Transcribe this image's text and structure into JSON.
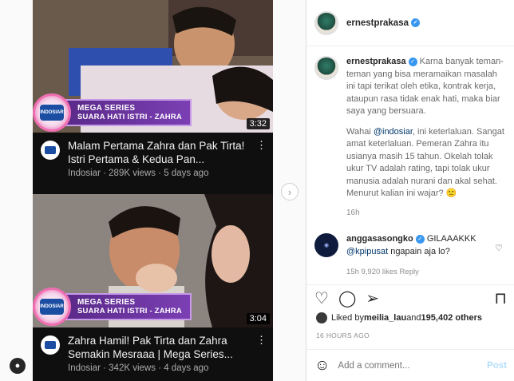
{
  "post": {
    "username": "ernestprakasa",
    "caption_p1": "Karna banyak teman-teman yang bisa meramaikan masalah ini tapi terikat oleh etika, kontrak kerja, ataupun rasa tidak enak hati, maka biar saya yang bersuara.",
    "caption_p2_a": "Wahai ",
    "caption_mention": "@indosiar",
    "caption_p2_b": ", ini keterlaluan. Sangat amat keterlaluan. Pemeran Zahra itu usianya masih 15 tahun. Okelah tolak ukur TV adalah rating, tapi tolak ukur manusia adalah nurani dan akal sehat. Menurut kalian ini wajar? 🙁",
    "caption_time": "16h",
    "likes_prefix": "Liked by ",
    "likes_user": "meilia_lau",
    "likes_mid": " and ",
    "likes_count": "195,402 others",
    "time_label": "16 HOURS AGO",
    "add_comment_placeholder": "Add a comment...",
    "post_label": "Post"
  },
  "comment": {
    "username": "anggasasongko",
    "text": "GILAAAKKK",
    "mention": "@kpipusat",
    "text2": " ngapain aja lo?",
    "meta": "15h   9,920 likes   Reply"
  },
  "videos": [
    {
      "title": "Malam Pertama Zahra dan Pak Tirta! Istri Pertama & Kedua Pan...",
      "channel": "Indosiar",
      "views": "289K views",
      "age": "5 days ago",
      "duration": "3:32",
      "banner_l1": "MEGA SERIES",
      "banner_l2": "SUARA HATI ISTRI - ZAHRA"
    },
    {
      "title": "Zahra Hamil! Pak Tirta dan Zahra Semakin Mesraaa | Mega Series...",
      "channel": "Indosiar",
      "views": "342K views",
      "age": "4 days ago",
      "duration": "3:04",
      "banner_l1": "MEGA SERIES",
      "banner_l2": "SUARA HATI ISTRI - ZAHRA"
    }
  ],
  "icons": {
    "heart": "heart-icon",
    "comment": "comment-icon",
    "share": "share-icon",
    "bookmark": "bookmark-icon",
    "emoji": "emoji-icon",
    "next": "chevron-right-icon"
  },
  "colors": {
    "verified": "#3897f0",
    "banner": "#7b3fb3",
    "post_button": "#b2dffc"
  }
}
